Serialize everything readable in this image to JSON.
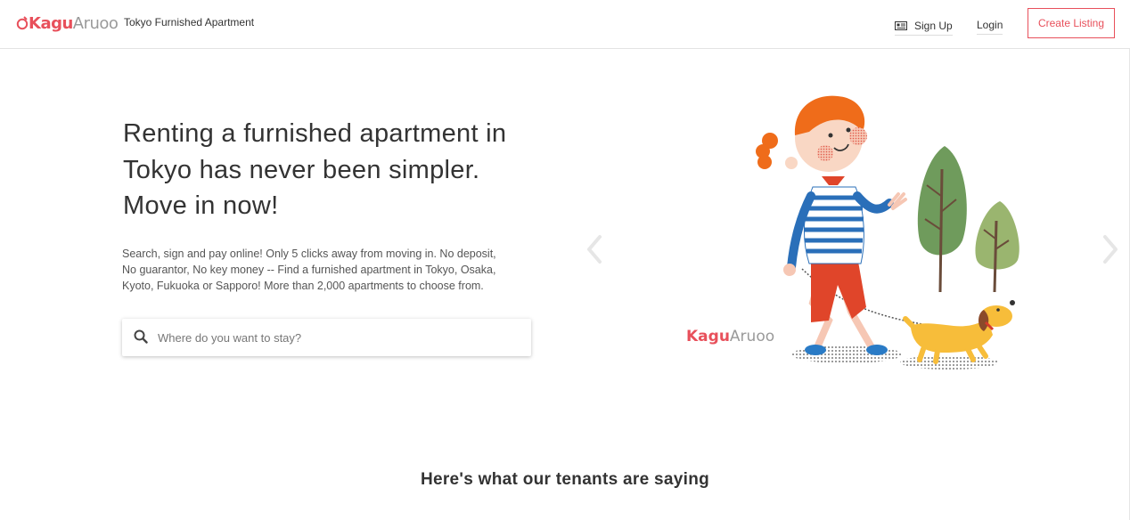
{
  "header": {
    "logo": {
      "part1": "Kagu",
      "part2": "Aruoo"
    },
    "tagline": "Tokyo Furnished Apartment",
    "nav": {
      "signup_label": "Sign Up",
      "login_label": "Login",
      "create_listing_label": "Create Listing"
    }
  },
  "hero": {
    "title_lines": [
      "Renting a furnished apartment in",
      "Tokyo has never been simpler.",
      "Move in now!"
    ],
    "description_lines": [
      "Search, sign and pay online! Only 5 clicks away from moving in. No deposit,",
      "No guarantor, No key money -- Find a furnished apartment in Tokyo, Osaka,",
      "Kyoto, Fukuoka or Sapporo! More than 2,000 apartments to choose from."
    ],
    "search": {
      "placeholder": "Where do you want to stay?",
      "value": ""
    },
    "carousel": {
      "image_logo": {
        "part1": "Kagu",
        "part2": "Aruoo"
      }
    }
  },
  "testimonials": {
    "title": "Here's what our tenants are saying"
  },
  "colors": {
    "brand": "#e8505b",
    "text": "#333333",
    "muted": "#9a9a9a"
  },
  "icons": {
    "logo": "ring-logo-icon",
    "signup": "id-card-icon",
    "search": "search-icon",
    "prev": "chevron-left-icon",
    "next": "chevron-right-icon"
  }
}
